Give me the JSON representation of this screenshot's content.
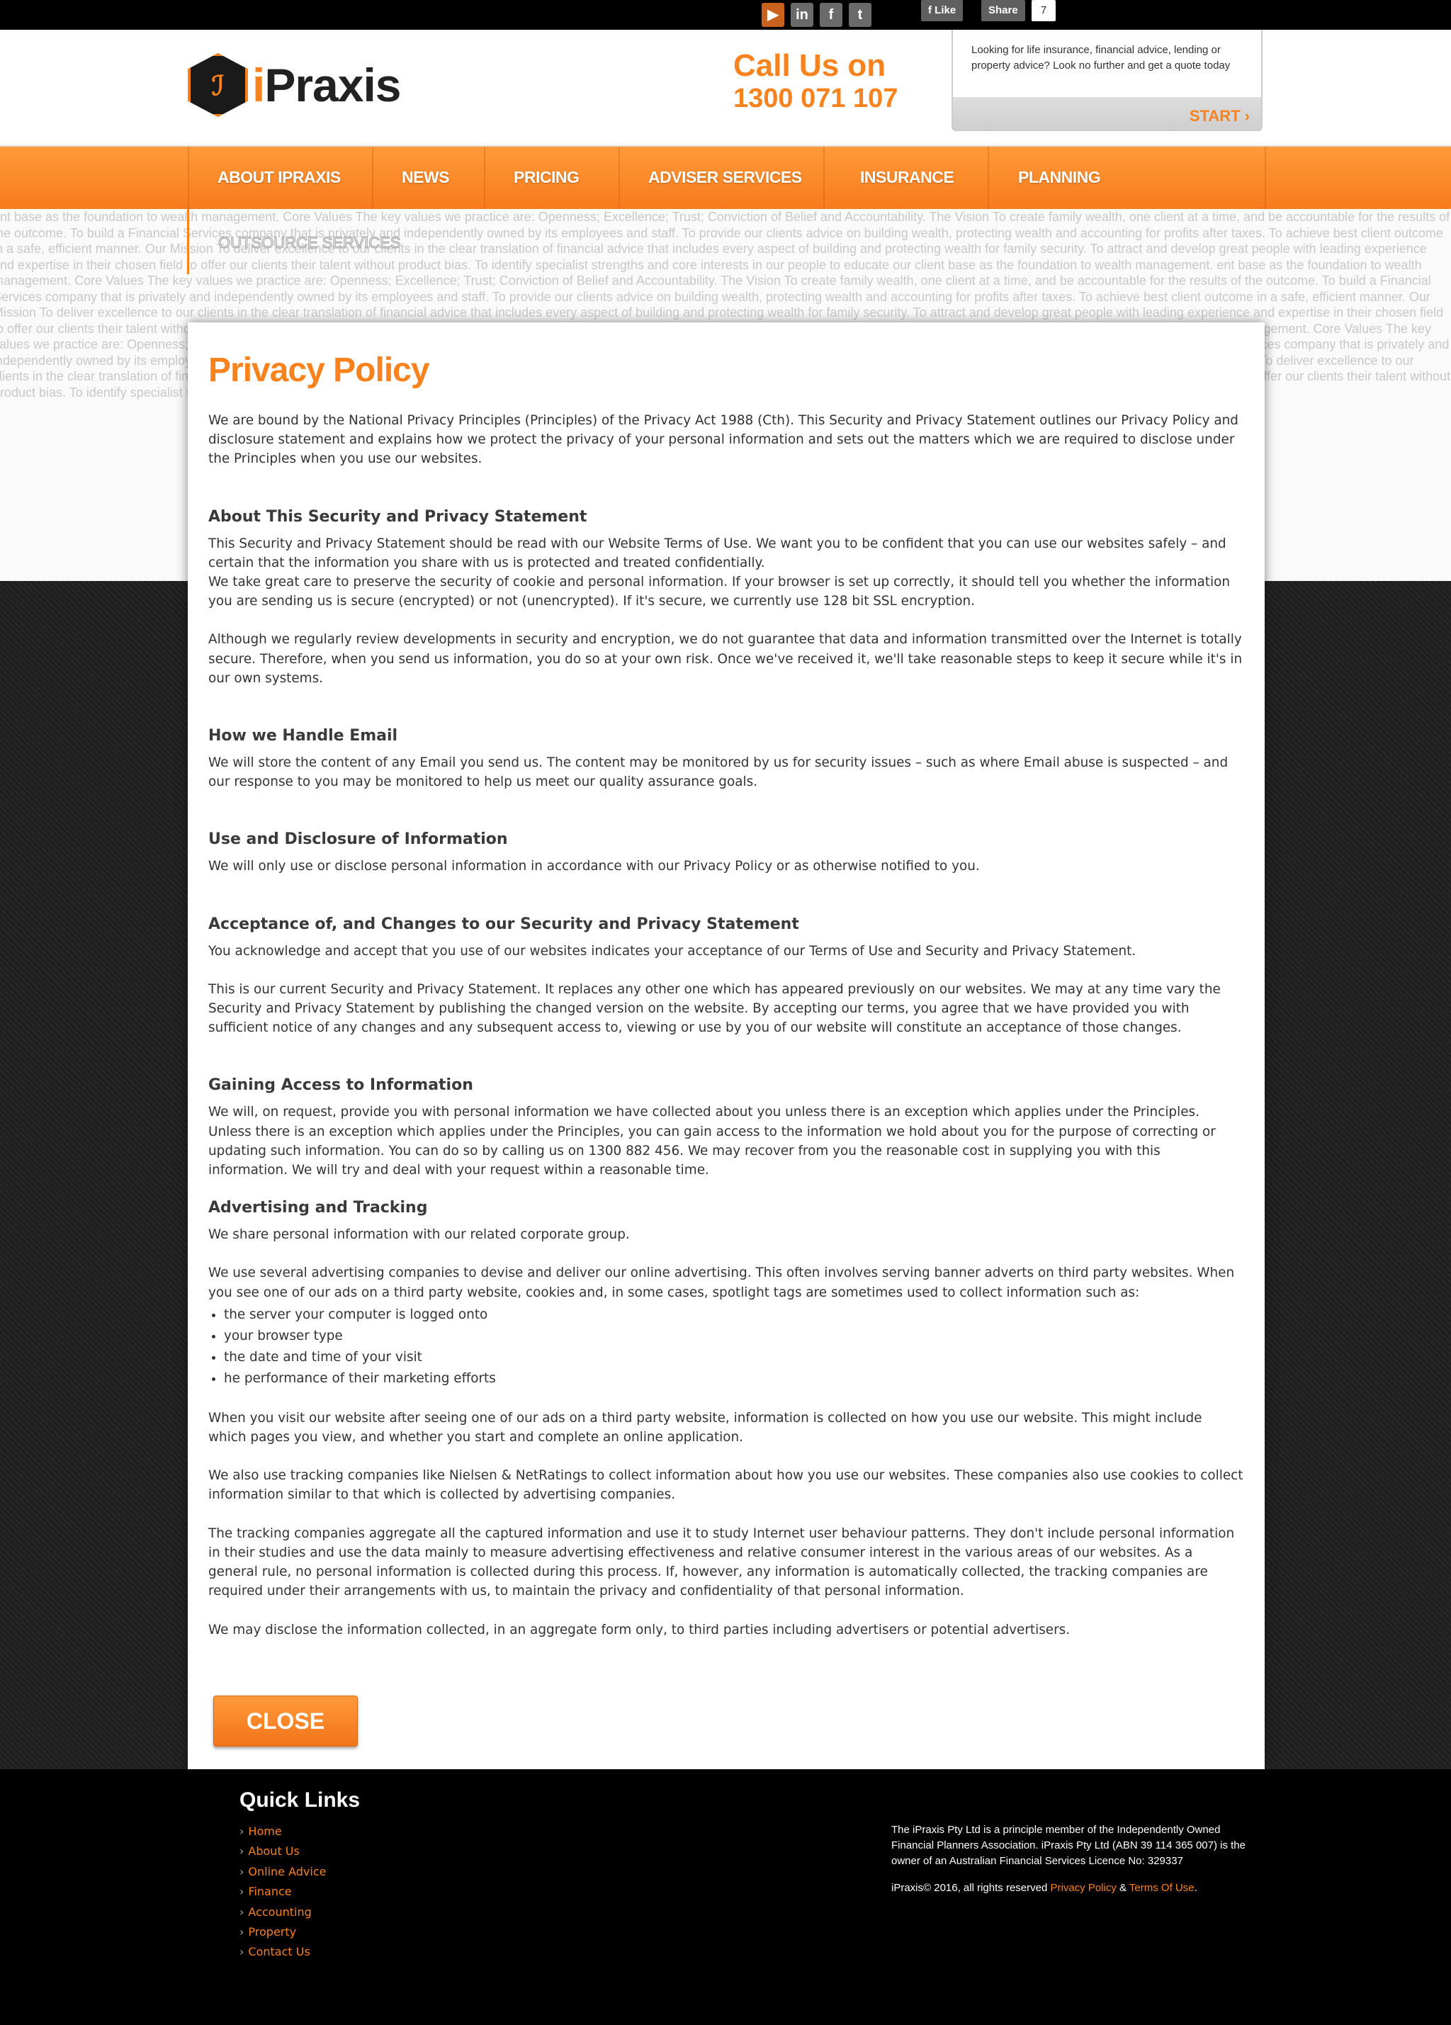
{
  "colors": {
    "accent": "#f7821e",
    "footer_bg": "#000000"
  },
  "topbar": {
    "social": [
      {
        "icon": "youtube-icon",
        "glyph": "▶"
      },
      {
        "icon": "linkedin-icon",
        "glyph": "in"
      },
      {
        "icon": "facebook-icon",
        "glyph": "f"
      },
      {
        "icon": "twitter-icon",
        "glyph": "t"
      }
    ],
    "like_label": "Like",
    "share_label": "Share",
    "share_count": "7"
  },
  "header": {
    "logo_text_i": "i",
    "logo_text_rest": "Praxis",
    "call_label": "Call Us on",
    "phone": "1300 071 107",
    "quote_text": "Looking for life insurance, financial advice, lending or property advice? Look no further and get a quote today",
    "start_label": "START ›"
  },
  "nav": {
    "items": [
      "ABOUT IPRAXIS",
      "NEWS",
      "PRICING",
      "ADVISER SERVICES",
      "INSURANCE",
      "PLANNING"
    ],
    "sub_item": "OUTSOURCE SERVICES"
  },
  "background_text": "ent base as the foundation to wealth management. Core Values The key values we practice are: Openness; Excellence; Trust; Conviction of Belief and Accountability. The Vision To create family wealth, one client at a time, and be accountable for the results of the outcome. To build a Financial Services company that is privately and independently owned by its employees and staff. To provide our clients advice on building wealth, protecting wealth and accounting for profits after taxes. To achieve best client outcome in a safe, efficient manner. Our Mission To deliver excellence to our clients in the clear translation of financial advice that includes every aspect of building and protecting wealth for family security. To attract and develop great people with leading experience and expertise in their chosen field to offer our clients their talent without product bias. To identify specialist strengths and core interests in our people to educate our client base as the foundation to wealth management.",
  "modal": {
    "title": "Privacy Policy",
    "intro": "We are bound by the National Privacy Principles (Principles) of the Privacy Act 1988 (Cth). This Security and Privacy Statement outlines our Privacy Policy and disclosure statement and explains how we protect the privacy of your personal information and sets out the matters which we are required to disclose under the Principles when you use our websites.",
    "s1_heading": "About This Security and Privacy Statement",
    "s1_p1": "This Security and Privacy Statement should be read with our Website Terms of Use. We want you to be confident that you can use our websites safely – and certain that the information you share with us is protected and treated confidentially.",
    "s1_p2": "We take great care to preserve the security of cookie and personal information. If your browser is set up correctly, it should tell you whether the information you are sending us is secure (encrypted) or not (unencrypted). If it's secure, we currently use 128 bit SSL encryption.",
    "s1_p3": "Although we regularly review developments in security and encryption, we do not guarantee that data and information transmitted over the Internet is totally secure. Therefore, when you send us information, you do so at your own risk. Once we've received it, we'll take reasonable steps to keep it secure while it's in our own systems.",
    "s2_heading": "How we Handle Email",
    "s2_p1": "We will store the content of any Email you send us. The content may be monitored by us for security issues – such as where Email abuse is suspected – and our response to you may be monitored to help us meet our quality assurance goals.",
    "s3_heading": "Use and Disclosure of Information",
    "s3_p1": "We will only use or disclose personal information in accordance with our Privacy Policy or as otherwise notified to you.",
    "s4_heading": "Acceptance of, and Changes to our Security and Privacy Statement",
    "s4_p1": "You acknowledge and accept that you use of our websites indicates your acceptance of our Terms of Use and Security and Privacy Statement.",
    "s4_p2": "This is our current Security and Privacy Statement. It replaces any other one which has appeared previously on our websites. We may at any time vary the Security and Privacy Statement by publishing the changed version on the website. By accepting our terms, you agree that we have provided you with sufficient notice of any changes and any subsequent access to, viewing or use by you of our website will constitute an acceptance of those changes.",
    "s5_heading": "Gaining Access to Information",
    "s5_p1": "We will, on request, provide you with personal information we have collected about you unless there is an exception which applies under the Principles. Unless there is an exception which applies under the Principles, you can gain access to the information we hold about you for the purpose of correcting or updating such information. You can do so by calling us on 1300 882 456. We may recover from you the reasonable cost in supplying you with this information. We will try and deal with your request within a reasonable time.",
    "s6_heading": "Advertising and Tracking",
    "s6_p1": "We share personal information with our related corporate group.",
    "s6_p2": "We use several advertising companies to devise and deliver our online advertising. This often involves serving banner adverts on third party websites. When you see one of our ads on a third party website, cookies and, in some cases, spotlight tags are sometimes used to collect information such as:",
    "s6_list": [
      "the server your computer is logged onto",
      "your browser type",
      "the date and time of your visit",
      "he performance of their marketing efforts"
    ],
    "s6_p3": "When you visit our website after seeing one of our ads on a third party website, information is collected on how you use our website. This might include which pages you view, and whether you start and complete an online application.",
    "s6_p4": "We also use tracking companies like Nielsen & NetRatings to collect information about how you use our websites. These companies also use cookies to collect information similar to that which is collected by advertising companies.",
    "s6_p5": "The tracking companies aggregate all the captured information and use it to study Internet user behaviour patterns. They don't include personal information in their studies and use the data mainly to measure advertising effectiveness and relative consumer interest in the various areas of our websites. As a general rule, no personal information is collected during this process. If, however, any information is automatically collected, the tracking companies are required under their arrangements with us, to maintain the privacy and confidentiality of that personal information.",
    "s6_p6": "We may disclose the information collected, in an aggregate form only, to third parties including advertisers or potential advertisers.",
    "close_label": "CLOSE"
  },
  "footer": {
    "quick_links_title": "Quick Links",
    "links": [
      "Home",
      "About Us",
      "Online Advice",
      "Finance",
      "Accounting",
      "Property",
      "Contact Us"
    ],
    "legal_text": "The iPraxis Pty Ltd is a principle member of the Independently Owned Financial Planners Association. iPraxis Pty Ltd (ABN 39 114 365 007) is the owner of an Australian Financial Services Licence No: 329337",
    "copyright": "iPraxis© 2016, all rights reserved ",
    "privacy_link": "Privacy Policy",
    "amp": " & ",
    "terms_link": "Terms Of Use",
    "period": "."
  }
}
